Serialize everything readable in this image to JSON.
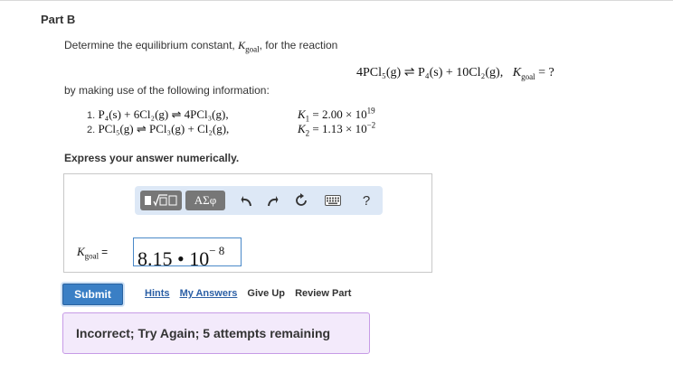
{
  "part": {
    "title": "Part B"
  },
  "prompt": {
    "determine_text": "Determine the equilibrium constant,",
    "determine_tail": ", for the reaction",
    "kgoal_symbol": "K",
    "kgoal_sub": "goal",
    "by_making_use": "by making use of the following information:",
    "express": "Express your answer numerically."
  },
  "target_reaction": {
    "text": "4PCl₅(g) ⇌ P₄(s) + 10Cl₂(g),",
    "k_eq": "= ?"
  },
  "info": [
    {
      "number": "1.",
      "reaction": "P₄(s) + 6Cl₂(g) ⇌ 4PCl₃(g),",
      "k_symbol": "K",
      "k_sub": "1",
      "k_value": "= 2.00 × 10",
      "k_exp": "19"
    },
    {
      "number": "2.",
      "reaction": "PCl₅(g) ⇌ PCl₃(g) + Cl₂(g),",
      "k_symbol": "K",
      "k_sub": "2",
      "k_value": "= 1.13 × 10",
      "k_exp": "−2"
    }
  ],
  "toolbar": {
    "greek_label": "ΑΣφ",
    "help_label": "?"
  },
  "answer": {
    "label_eq": "=",
    "mantissa": "8.15 • 10",
    "exponent": "− 8"
  },
  "actions": {
    "submit": "Submit",
    "hints": "Hints",
    "my_answers": "My Answers",
    "give_up": "Give Up",
    "review_part": "Review Part"
  },
  "feedback": {
    "message": "Incorrect; Try Again; 5 attempts remaining"
  },
  "colors": {
    "accent": "#3a7fc5",
    "toolbar_bg": "#dde8f6",
    "feedback_bg": "#f3eafb",
    "feedback_border": "#c79be6"
  }
}
